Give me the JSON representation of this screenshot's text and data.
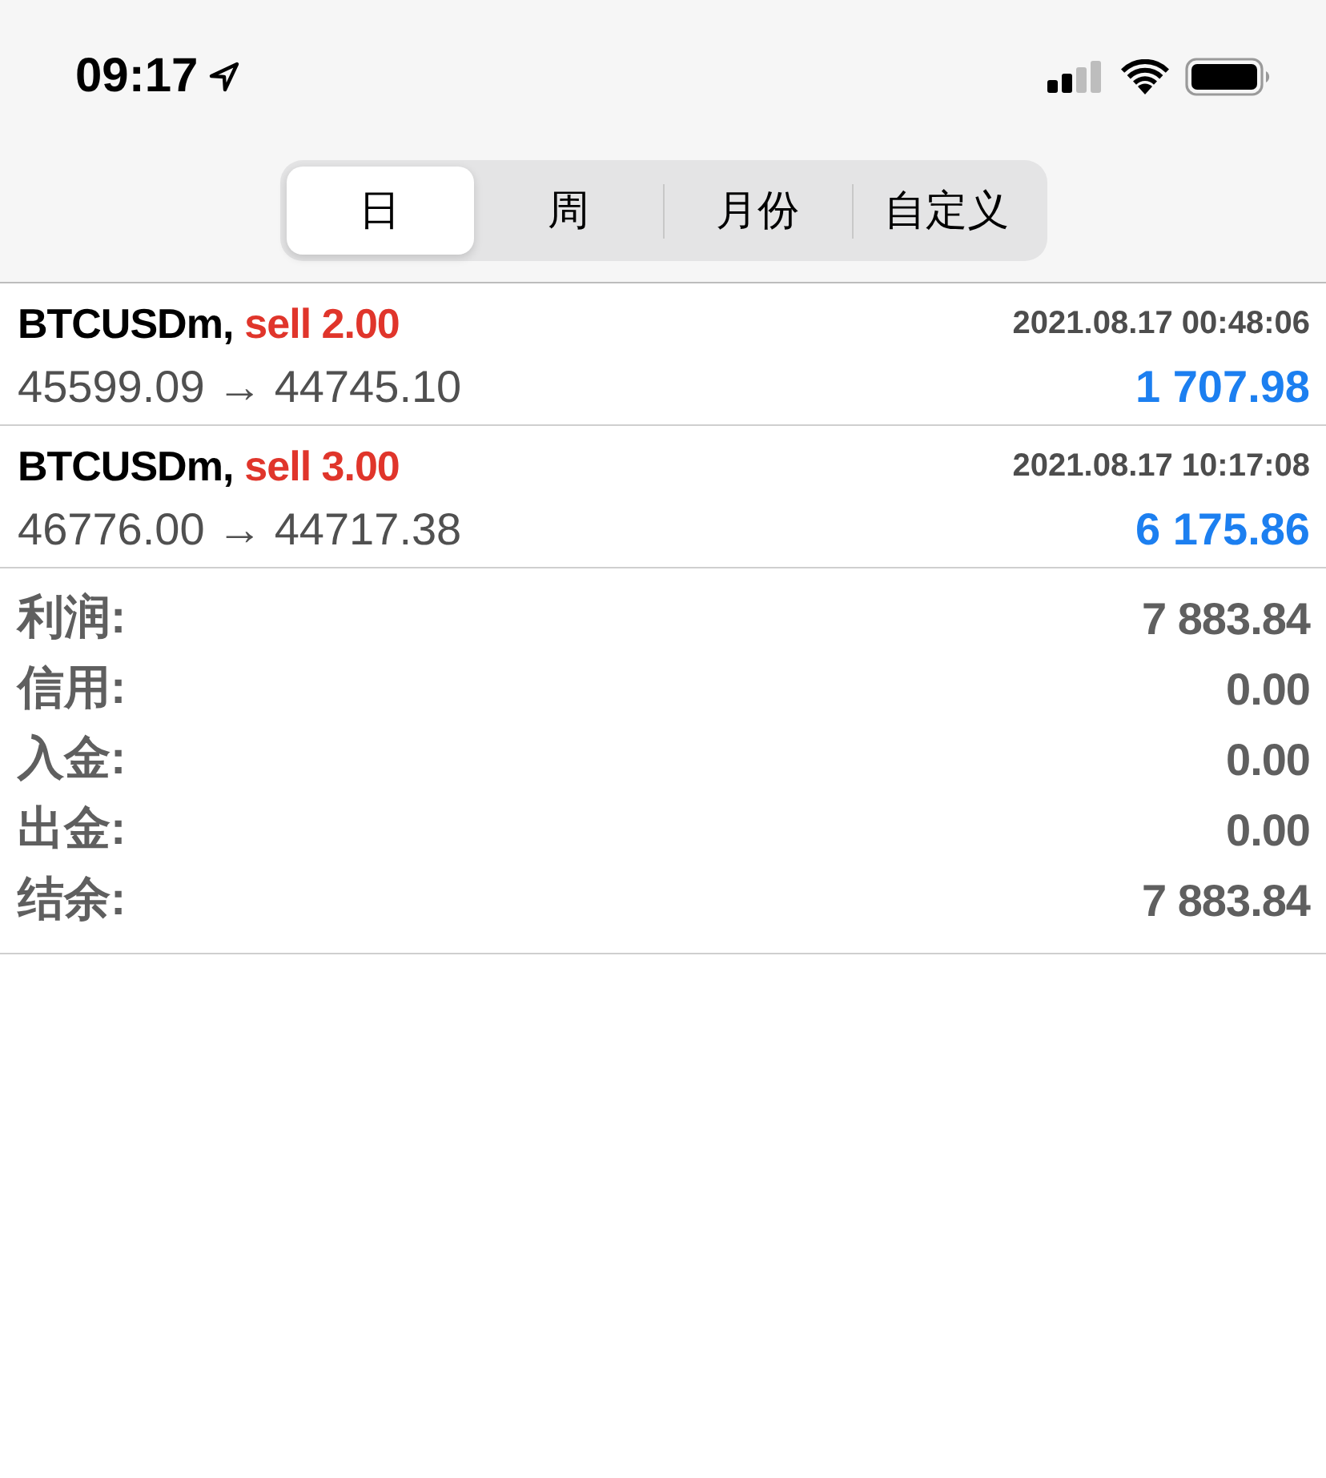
{
  "status_bar": {
    "time": "09:17"
  },
  "period_tabs": [
    {
      "label": "日",
      "selected": true
    },
    {
      "label": "周",
      "selected": false
    },
    {
      "label": "月份",
      "selected": false
    },
    {
      "label": "自定义",
      "selected": false
    }
  ],
  "deals": [
    {
      "symbol": "BTCUSDm,",
      "side": "sell 2.00",
      "time": "2021.08.17 00:48:06",
      "prices": "45599.09 → 44745.10",
      "profit": "1 707.98"
    },
    {
      "symbol": "BTCUSDm,",
      "side": "sell 3.00",
      "time": "2021.08.17 10:17:08",
      "prices": "46776.00 → 44717.38",
      "profit": "6 175.86"
    }
  ],
  "summary": [
    {
      "label": "利润:",
      "value": "7 883.84"
    },
    {
      "label": "信用:",
      "value": "0.00"
    },
    {
      "label": "入金:",
      "value": "0.00"
    },
    {
      "label": "出金:",
      "value": "0.00"
    },
    {
      "label": "结余:",
      "value": "7 883.84"
    }
  ]
}
